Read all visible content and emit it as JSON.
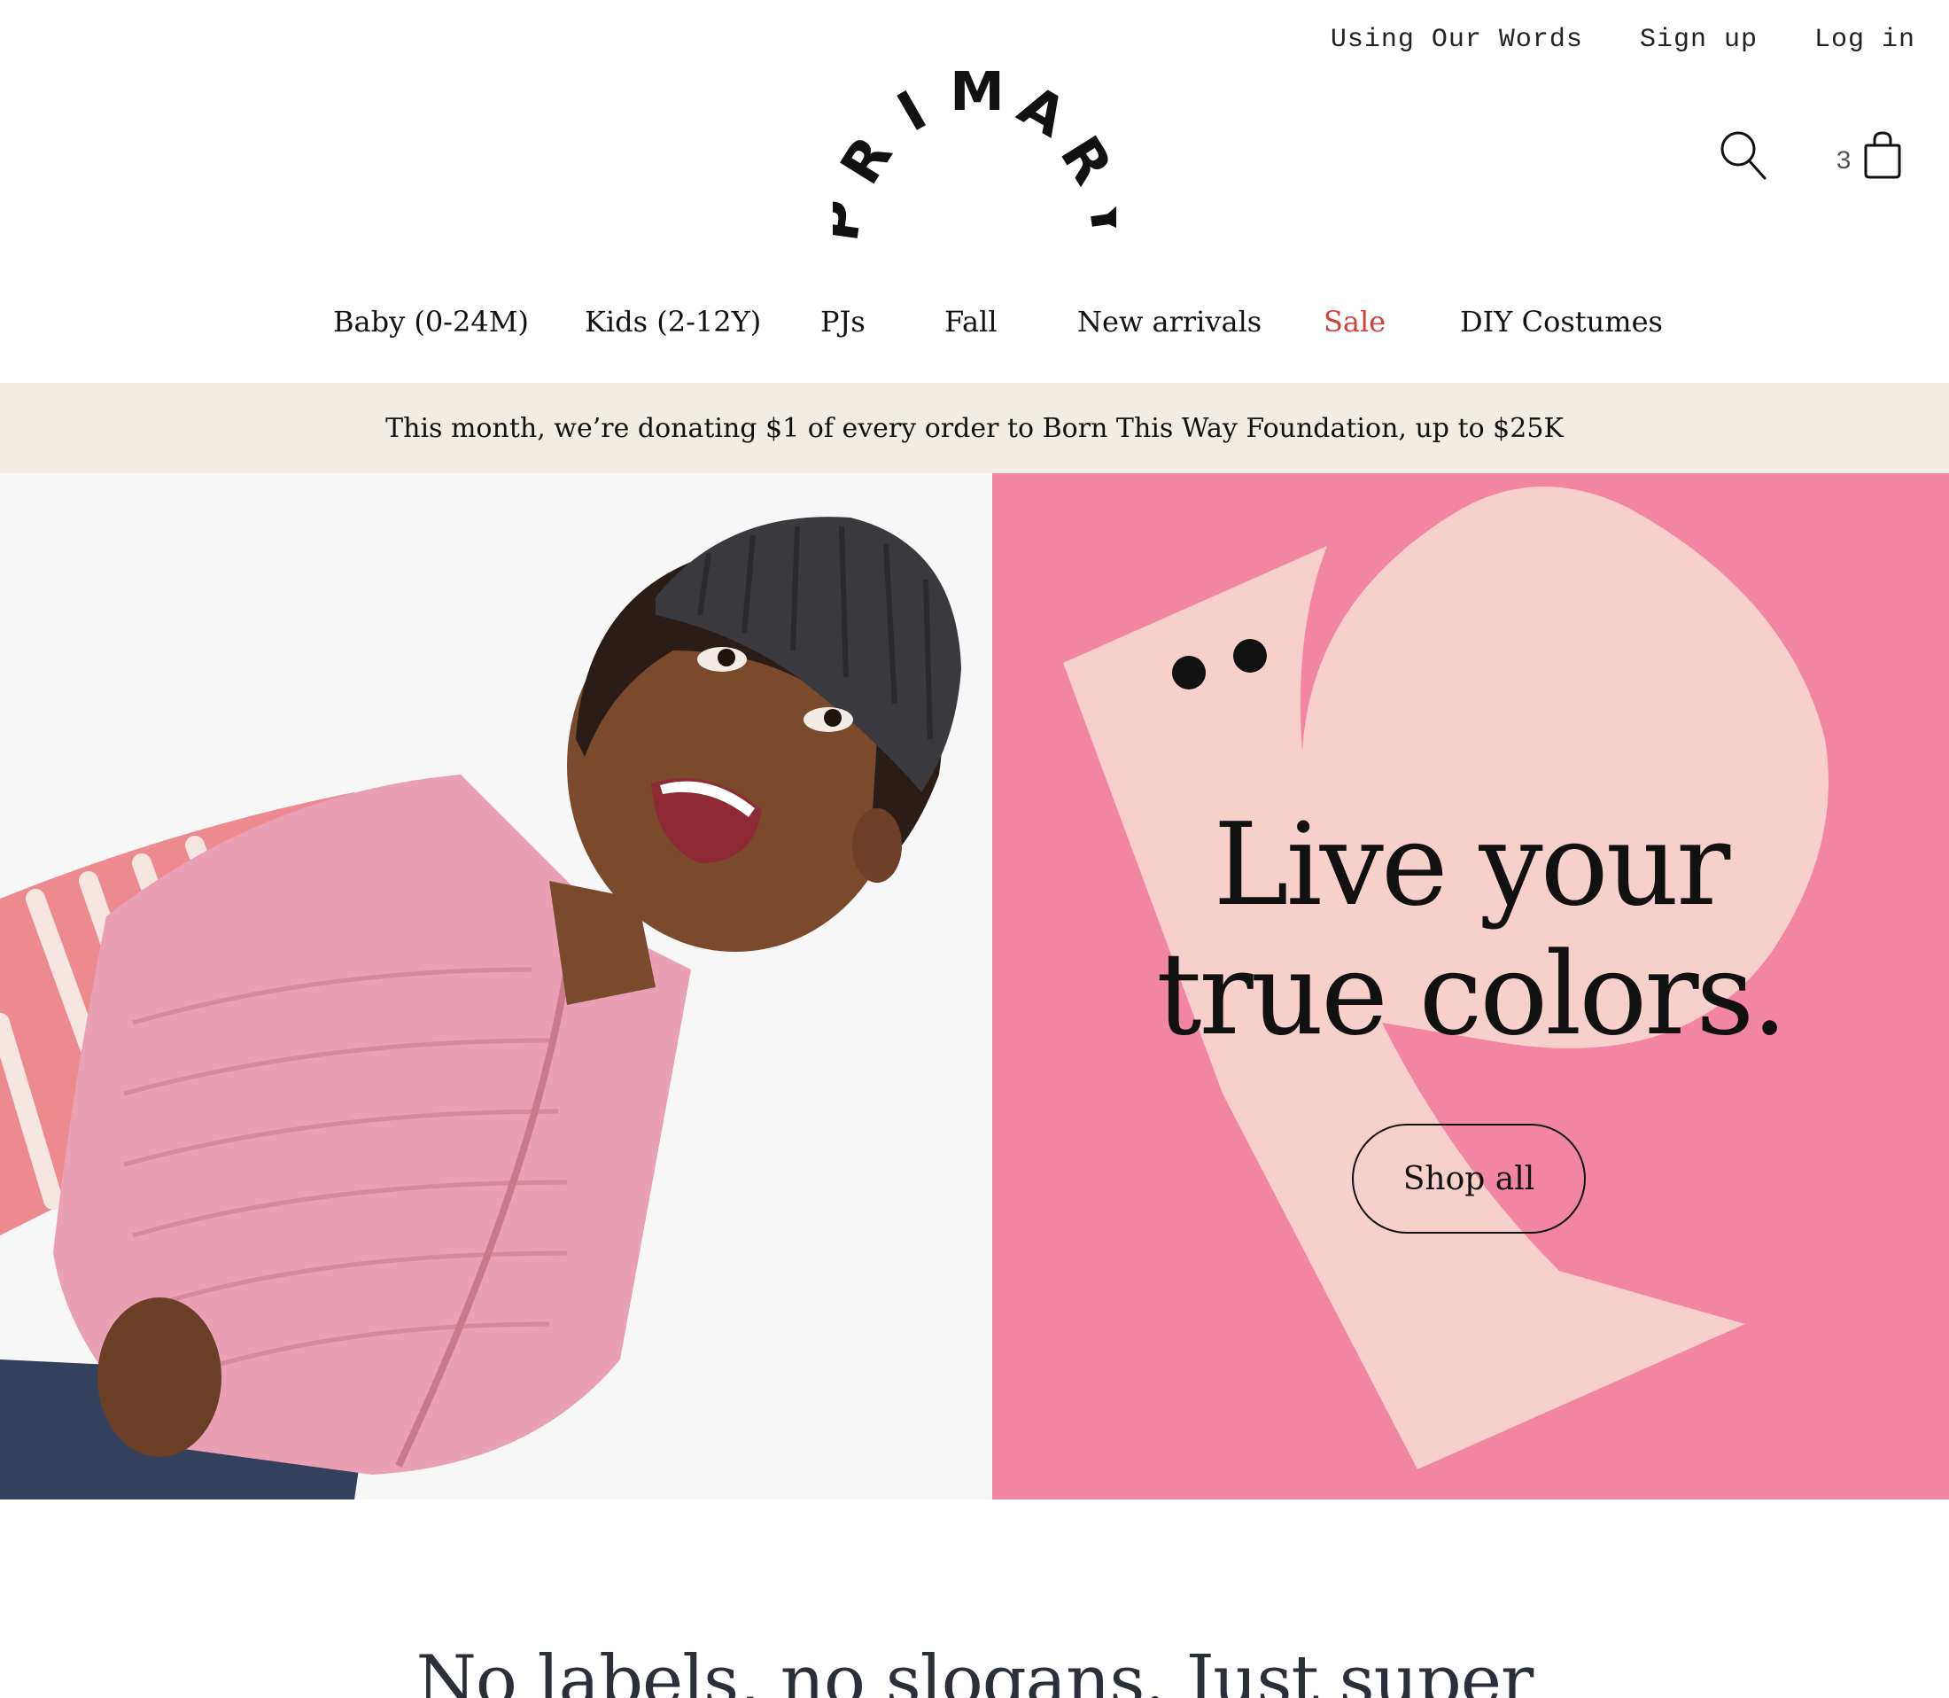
{
  "utility_nav": {
    "using_our_words": "Using Our Words",
    "sign_up": "Sign up",
    "log_in": "Log in"
  },
  "brand": {
    "logo_letters": [
      "P",
      "R",
      "I",
      "M",
      "A",
      "R",
      "Y"
    ]
  },
  "cart": {
    "count": "3"
  },
  "icons": {
    "search": "search-icon",
    "cart": "shopping-bag-icon"
  },
  "main_nav": {
    "items": [
      {
        "label": "Baby (0-24M)"
      },
      {
        "label": "Kids (2-12Y)"
      },
      {
        "label": "PJs"
      },
      {
        "label": "Fall"
      },
      {
        "label": "New arrivals"
      },
      {
        "label": "Sale"
      },
      {
        "label": "DIY Costumes"
      }
    ]
  },
  "promo_banner": {
    "text": "This month, we’re donating $1 of every order to Born This Way Foundation, up to $25K"
  },
  "hero": {
    "headline_line1": "Live your",
    "headline_line2": "true colors.",
    "cta_label": "Shop all"
  },
  "section": {
    "tagline": "No labels, no slogans. Just super"
  },
  "colors": {
    "sale": "#d2403c",
    "promo_bg": "#f1ede4",
    "hero_pink": "#f285a4",
    "hero_shape": "#f7cfcb",
    "tagline": "#2b2f3a"
  }
}
